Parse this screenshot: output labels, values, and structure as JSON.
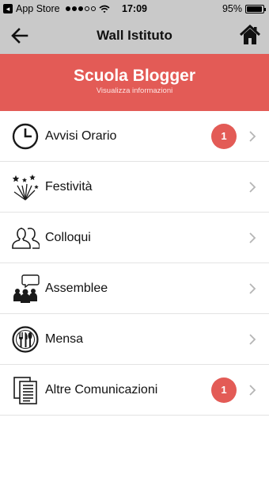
{
  "status_bar": {
    "carrier": "App Store",
    "back_glyph": "◂",
    "time": "17:09",
    "battery": "95%",
    "battery_level": 0.95
  },
  "nav": {
    "title": "Wall Istituto",
    "back_icon": "arrow-left-icon",
    "home_icon": "home-icon"
  },
  "banner": {
    "title": "Scuola Blogger",
    "subtitle": "Visualizza informazioni",
    "color": "#e35b56"
  },
  "menu": {
    "items": [
      {
        "label": "Avvisi Orario",
        "icon": "clock-icon",
        "badge": "1"
      },
      {
        "label": "Festività",
        "icon": "fireworks-icon",
        "badge": ""
      },
      {
        "label": "Colloqui",
        "icon": "people-icon",
        "badge": ""
      },
      {
        "label": "Assemblee",
        "icon": "meeting-icon",
        "badge": ""
      },
      {
        "label": "Mensa",
        "icon": "cutlery-icon",
        "badge": ""
      },
      {
        "label": "Altre Comunicazioni",
        "icon": "documents-icon",
        "badge": "1"
      }
    ]
  }
}
